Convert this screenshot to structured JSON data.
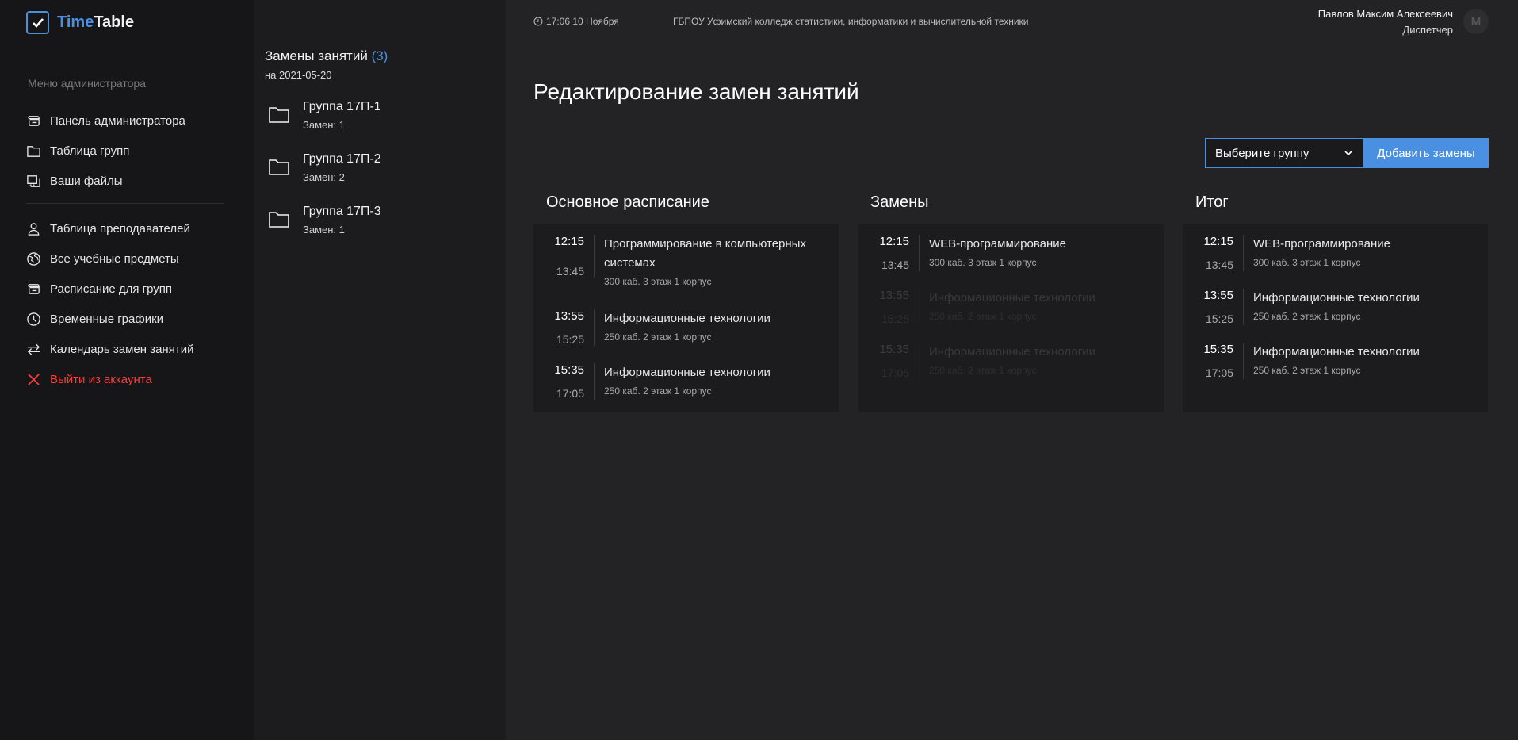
{
  "app": {
    "logo_time": "Time",
    "logo_table": "Table"
  },
  "sidebar": {
    "caption": "Меню администратора",
    "items": [
      {
        "label": "Панель администратора",
        "icon": "dashboard-icon"
      },
      {
        "label": "Таблица групп",
        "icon": "folder-icon"
      },
      {
        "label": "Ваши файлы",
        "icon": "files-icon"
      },
      {
        "label": "Таблица преподавателей",
        "icon": "user-icon"
      },
      {
        "label": "Все учебные предметы",
        "icon": "globe-icon"
      },
      {
        "label": "Расписание для групп",
        "icon": "schedule-icon"
      },
      {
        "label": "Временные графики",
        "icon": "clock-icon"
      },
      {
        "label": "Календарь замен занятий",
        "icon": "swap-icon"
      },
      {
        "label": "Выйти из аккаунта",
        "icon": "close-icon"
      }
    ]
  },
  "changes_panel": {
    "title": "Замены занятий",
    "count": "(3)",
    "date": "на 2021-05-20",
    "groups": [
      {
        "name": "Группа 17П-1",
        "sub": "Замен: 1"
      },
      {
        "name": "Группа 17П-2",
        "sub": "Замен: 2"
      },
      {
        "name": "Группа 17П-3",
        "sub": "Замен: 1"
      }
    ]
  },
  "topbar": {
    "time": "17:06 10 Ноября",
    "org": "ГБПОУ Уфимский колледж статистики, информатики и вычислительной техники",
    "user_name": "Павлов Максим Алексеевич",
    "user_role": "Диспетчер",
    "avatar_letter": "М"
  },
  "main": {
    "title": "Редактирование замен занятий",
    "select_placeholder": "Выберите группу",
    "add_button": "Добавить замены",
    "columns": [
      {
        "title": "Основное расписание",
        "lessons": [
          {
            "start": "12:15",
            "end": "13:45",
            "subject": "Программирование в компьютерных системах",
            "room": "300 каб. 3 этаж 1 корпус",
            "dim": false
          },
          {
            "start": "13:55",
            "end": "15:25",
            "subject": "Информационные технологии",
            "room": "250 каб. 2 этаж 1 корпус",
            "dim": false
          },
          {
            "start": "15:35",
            "end": "17:05",
            "subject": "Информационные технологии",
            "room": "250 каб. 2 этаж 1 корпус",
            "dim": false
          }
        ]
      },
      {
        "title": "Замены",
        "lessons": [
          {
            "start": "12:15",
            "end": "13:45",
            "subject": "WEB-программирование",
            "room": "300 каб. 3 этаж 1 корпус",
            "dim": false
          },
          {
            "start": "13:55",
            "end": "15:25",
            "subject": "Информационные технологии",
            "room": "250 каб. 2 этаж 1 корпус",
            "dim": true
          },
          {
            "start": "15:35",
            "end": "17:05",
            "subject": "Информационные технологии",
            "room": "250 каб. 2 этаж 1 корпус",
            "dim": true
          }
        ]
      },
      {
        "title": "Итог",
        "lessons": [
          {
            "start": "12:15",
            "end": "13:45",
            "subject": "WEB-программирование",
            "room": "300 каб. 3 этаж 1 корпус",
            "dim": false
          },
          {
            "start": "13:55",
            "end": "15:25",
            "subject": "Информационные технологии",
            "room": "250 каб. 2 этаж 1 корпус",
            "dim": false
          },
          {
            "start": "15:35",
            "end": "17:05",
            "subject": "Информационные технологии",
            "room": "250 каб. 2 этаж 1 корпус",
            "dim": false
          }
        ]
      }
    ]
  },
  "colors": {
    "accent": "#4a90e2",
    "danger": "#ff3b3b",
    "background": "#232325",
    "sidebar": "#161618"
  }
}
